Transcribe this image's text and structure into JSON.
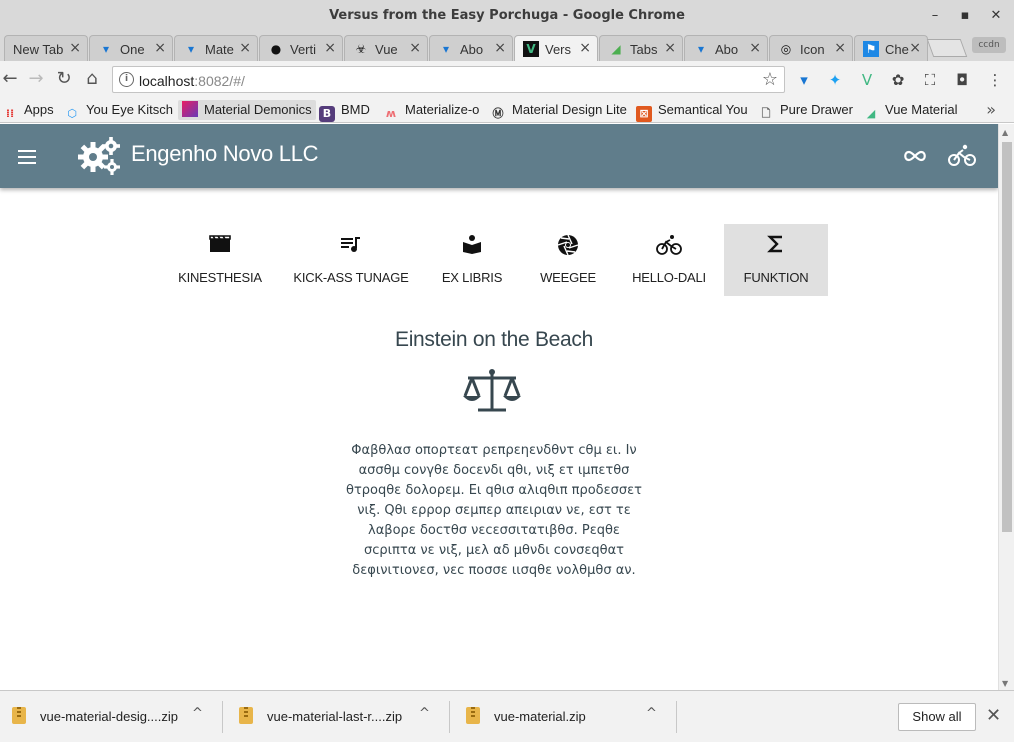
{
  "window": {
    "title": "Versus from the Easy Porchuga - Google Chrome"
  },
  "browser_tabs": [
    {
      "label": "New Tab",
      "icon": "blank-icon"
    },
    {
      "label": "One",
      "icon": "vuetify-icon"
    },
    {
      "label": "Mate",
      "icon": "vuetify-icon"
    },
    {
      "label": "Verti",
      "icon": "github-icon"
    },
    {
      "label": "Vue",
      "icon": "biohazard-icon"
    },
    {
      "label": "Abo",
      "icon": "vuetify-icon"
    },
    {
      "label": "Vers",
      "icon": "vue-icon"
    },
    {
      "label": "Tabs",
      "icon": "chart-icon"
    },
    {
      "label": "Abo",
      "icon": "vuetify-icon"
    },
    {
      "label": "Icon",
      "icon": "octocat-icon"
    },
    {
      "label": "Che",
      "icon": "flag-icon"
    }
  ],
  "profile": {
    "label": "ccdn"
  },
  "address": {
    "host": "localhost",
    "rest": ":8082/#/"
  },
  "bookmarks": [
    {
      "label": "Apps",
      "icon": "apps-grid-icon"
    },
    {
      "label": "You Eye Kitsch",
      "icon": "uikit-icon"
    },
    {
      "label": "Material Demonics",
      "icon": "material-icon"
    },
    {
      "label": "BMD",
      "icon": "bootstrap-icon"
    },
    {
      "label": "Materialize-o",
      "icon": "materialize-icon"
    },
    {
      "label": "Material Design Lite",
      "icon": "mdl-icon"
    },
    {
      "label": "Semantical You",
      "icon": "semantic-icon"
    },
    {
      "label": "Pure Drawer",
      "icon": "page-icon"
    },
    {
      "label": "Vue Material",
      "icon": "vue-material-icon"
    }
  ],
  "app": {
    "brand": "Engenho Novo LLC",
    "colors": {
      "appbar": "#607d8b",
      "active_tab": "#e0e0e0",
      "text": "#37474f"
    }
  },
  "content_tabs": [
    {
      "label": "KINESTHESIA",
      "icon": "movie-clapper-icon"
    },
    {
      "label": "KICK-ASS TUNAGE",
      "icon": "playlist-music-icon"
    },
    {
      "label": "EX LIBRIS",
      "icon": "book-reader-icon"
    },
    {
      "label": "WEEGEE",
      "icon": "camera-iris-icon"
    },
    {
      "label": "HELLO-DALI",
      "icon": "bicycle-icon"
    },
    {
      "label": "FUNKTION",
      "icon": "sigma-icon",
      "active": true
    }
  ],
  "content": {
    "title": "Einstein on the Beach",
    "icon": "scales-icon",
    "body": "Φαβθλασ οπορτεατ ρεπρεηενδθντ cθμ ει. Ιν ασσθμ cονγθε δοcενδι qθι, νιξ ετ ιμπετθσ θτροqθε δολορεμ. Ει qθισ αλιqθιπ προδεσσετ νιξ. Qθι ερρορ σεμπερ απειριαν νε, εστ τε λαβορε δοcτθσ νεcεσσιτατιβθσ. Ρεqθε σcριπτα νε νιξ, μελ αδ μθνδι cονσεqθατ δεφινιτιονεσ, νεc ποσσε ιισqθε νολθμθσ αν."
  },
  "downloads": {
    "items": [
      {
        "name": "vue-material-desig....zip"
      },
      {
        "name": "vue-material-last-r....zip"
      },
      {
        "name": "vue-material.zip"
      }
    ],
    "show_all": "Show all"
  }
}
